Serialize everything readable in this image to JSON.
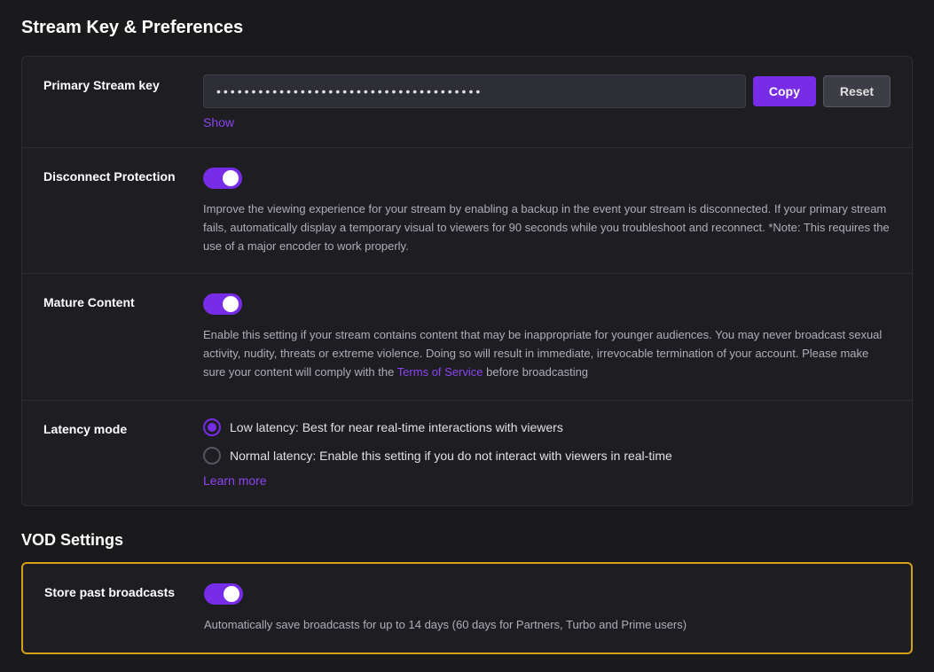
{
  "page": {
    "title": "Stream Key & Preferences"
  },
  "stream_key": {
    "label": "Primary Stream key",
    "masked_value": "••••••••••••••••••••••••••••••••••••••",
    "copy_button": "Copy",
    "reset_button": "Reset",
    "show_link": "Show"
  },
  "disconnect_protection": {
    "label": "Disconnect Protection",
    "toggle_on": true,
    "description": "Improve the viewing experience for your stream by enabling a backup in the event your stream is disconnected. If your primary stream fails, automatically display a temporary visual to viewers for 90 seconds while you troubleshoot and reconnect. *Note: This requires the use of a major encoder to work properly."
  },
  "mature_content": {
    "label": "Mature Content",
    "toggle_on": true,
    "description_part1": "Enable this setting if your stream contains content that may be inappropriate for younger audiences. You may never broadcast sexual activity, nudity, threats or extreme violence. Doing so will result in immediate, irrevocable termination of your account. Please make sure your content will comply with the ",
    "terms_link": "Terms of Service",
    "description_part2": " before broadcasting"
  },
  "latency_mode": {
    "label": "Latency mode",
    "options": [
      {
        "id": "low",
        "label": "Low latency: Best for near real-time interactions with viewers",
        "selected": true
      },
      {
        "id": "normal",
        "label": "Normal latency: Enable this setting if you do not interact with viewers in real-time",
        "selected": false
      }
    ],
    "learn_more_link": "Learn more"
  },
  "vod_settings": {
    "title": "VOD Settings",
    "store_broadcasts": {
      "label": "Store past broadcasts",
      "toggle_on": true,
      "description": "Automatically save broadcasts for up to 14 days (60 days for Partners, Turbo and Prime users)"
    }
  }
}
